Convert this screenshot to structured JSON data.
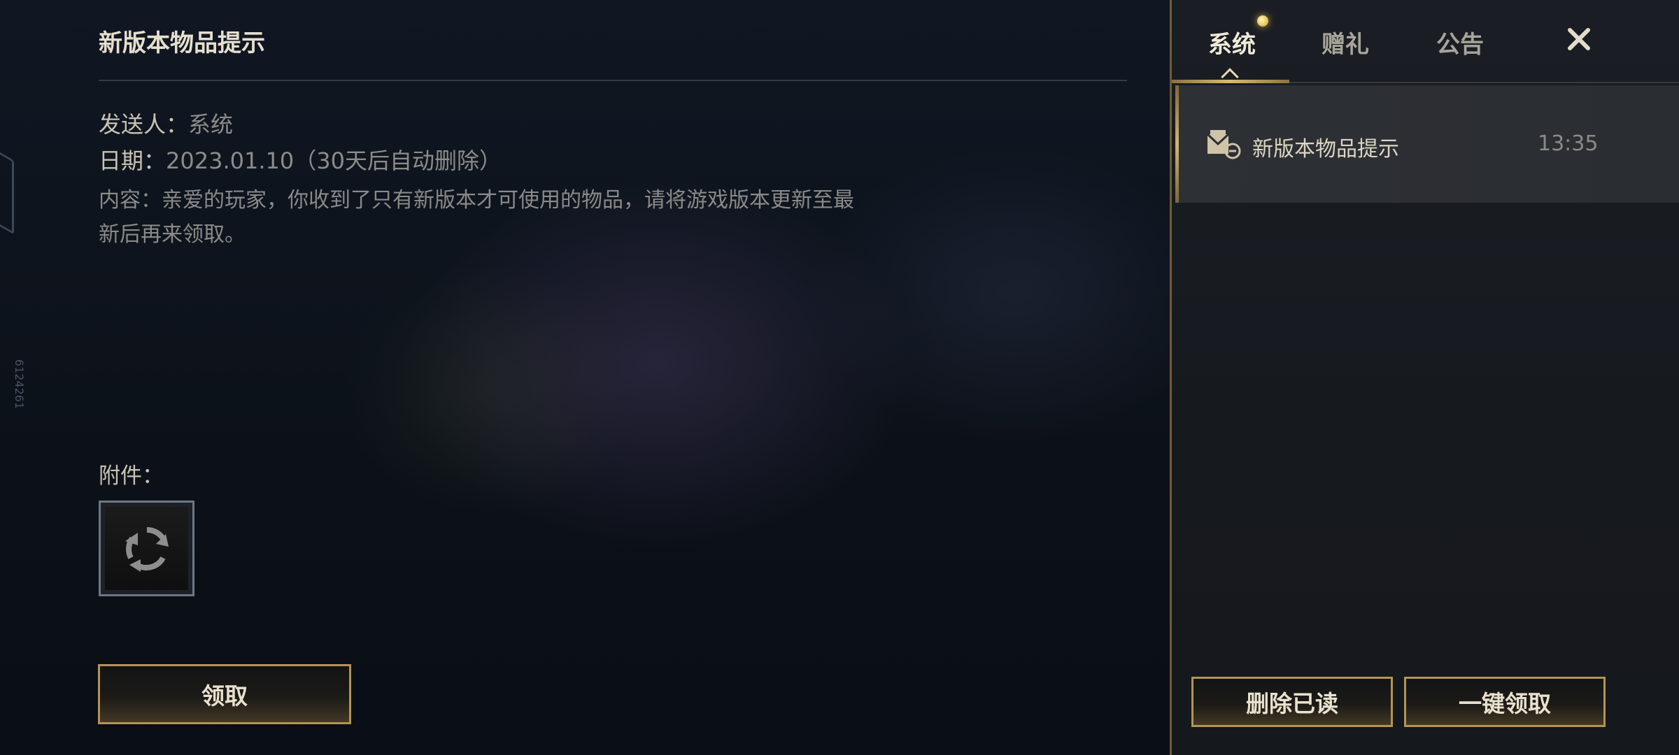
{
  "detail": {
    "title": "新版本物品提示",
    "sender_label": "发送人：",
    "sender_value": "系统",
    "date_label": "日期：",
    "date_value": "2023.01.10（30天后自动删除）",
    "content": "内容：亲爱的玩家，你收到了只有新版本才可使用的物品，请将游戏版本更新至最新后再来领取。",
    "attachment_label": "附件：",
    "attachment_icon": "refresh-icon",
    "claim_label": "领取",
    "side_text": "6124261"
  },
  "panel": {
    "tabs": [
      {
        "label": "系统",
        "active": true,
        "has_dot": true
      },
      {
        "label": "赠礼",
        "active": false
      },
      {
        "label": "公告",
        "active": false
      }
    ],
    "close_icon": "close-icon",
    "mails": [
      {
        "title": "新版本物品提示",
        "time": "13:35",
        "icon": "mail-envelope-icon",
        "selected": true
      }
    ],
    "delete_read_label": "删除已读",
    "claim_all_label": "一键领取"
  },
  "colors": {
    "accent_gold": "#b39453",
    "text_primary": "#e6dfcd",
    "text_secondary": "#8d8c88"
  }
}
